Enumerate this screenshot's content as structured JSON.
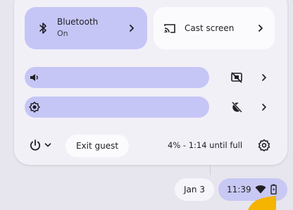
{
  "quick_settings": {
    "bluetooth": {
      "title": "Bluetooth",
      "status": "On",
      "icon": "bluetooth-icon"
    },
    "cast": {
      "label": "Cast screen",
      "icon": "cast-icon"
    },
    "volume": {
      "level_fraction": 1.0,
      "icon": "speaker-icon"
    },
    "brightness": {
      "level_fraction": 1.0,
      "icon": "brightness-icon"
    },
    "exit_guest_label": "Exit guest",
    "battery_status": "4% - 1:14 until full"
  },
  "shelf": {
    "date": "Jan 3",
    "time": "11:39"
  },
  "colors": {
    "accent_tile": "#c5c6f6",
    "panel": "#f2f0f7",
    "shelf": "#e7e6ee",
    "status_pill": "#c8c8f4",
    "cursor": "#f4b400"
  }
}
